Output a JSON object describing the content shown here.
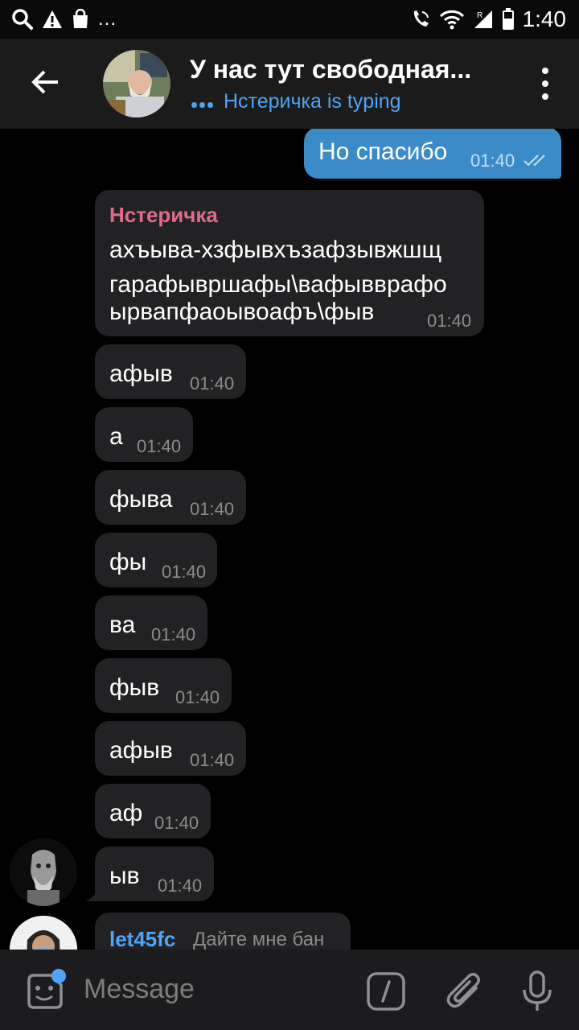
{
  "status_bar": {
    "time": "1:40",
    "more": "..."
  },
  "header": {
    "title": "У нас тут свободная...",
    "typing": "Нстеричка is typing"
  },
  "messages": {
    "outgoing": {
      "text": "Но спасибо",
      "time": "01:40"
    },
    "first": {
      "sender": "Нстеричка",
      "lines": [
        "ахъыва-хзфывхъзафзывжшщ",
        "гарафывршафы\\вафывврафо",
        "ырвапфаоывоафъ\\фыв"
      ],
      "time": "01:40"
    },
    "list": [
      {
        "text": "афыв",
        "time": "01:40"
      },
      {
        "text": "а",
        "time": "01:40"
      },
      {
        "text": "фыва",
        "time": "01:40"
      },
      {
        "text": "фы",
        "time": "01:40"
      },
      {
        "text": "ва",
        "time": "01:40"
      },
      {
        "text": "фыв",
        "time": "01:40"
      },
      {
        "text": "афыв",
        "time": "01:40"
      },
      {
        "text": "аф",
        "time": "01:40"
      },
      {
        "text": "ыв",
        "time": "01:40"
      }
    ],
    "last": {
      "sender": "let45fc",
      "text": "Дайте мне бан"
    }
  },
  "input": {
    "placeholder": "Message"
  },
  "colors": {
    "accent": "#4ea4f6",
    "outgoing_bubble": "#3a8bc8",
    "incoming_bubble": "#222224",
    "sender_name": "#e06c8a",
    "header_bg": "#1b1b1b"
  },
  "icons": [
    "search-icon",
    "warning-icon",
    "shopping-bag-icon",
    "wifi-call-icon",
    "wifi-icon",
    "signal-icon",
    "battery-icon",
    "back-arrow-icon",
    "more-vert-icon",
    "read-checks-icon",
    "sticker-icon",
    "command-icon",
    "attach-icon",
    "mic-icon"
  ]
}
